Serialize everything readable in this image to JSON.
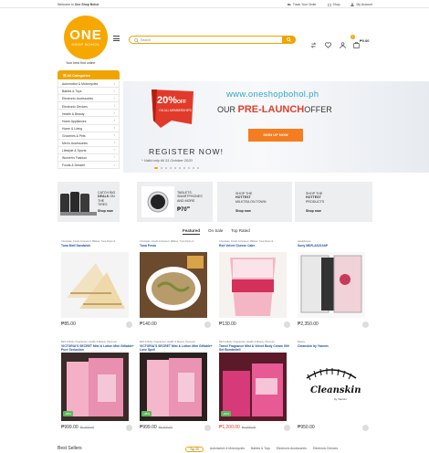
{
  "topbar": {
    "welcome_prefix": "Welcome to",
    "welcome_brand": "One Shop Bohol",
    "links": [
      "Track Your Order",
      "Shop",
      "My Account"
    ]
  },
  "header": {
    "logo_line1": "ONE",
    "logo_line2": "SHOP BOHOL",
    "tagline": "Your best find online",
    "search_placeholder": "Search",
    "cart_count": "0",
    "cart_total": "₱0.00",
    "accent_color": "#f0a400"
  },
  "categories": {
    "title": "All Categories",
    "items": [
      "Automotive & Motorcycles",
      "Babies & Toys",
      "Electronic Accessories",
      "Electronic Devices",
      "Health & Beauty",
      "Home Appliances",
      "Home & Living",
      "Groceries & Pets",
      "Men's Accessories",
      "Lifestyle & Sports",
      "Women's Fashion",
      "Foods & Dessert"
    ]
  },
  "hero": {
    "discount": "20%",
    "discount_off": "OFF",
    "discount_sub": "ON ALL MEMBERSHIPS",
    "register": "REGISTER NOW!",
    "valid": "* Valid only till 31 October 2020",
    "url": "www.oneshopbohol.ph",
    "prelaunch_pre": "OUR",
    "prelaunch_main": "PRE-LAUNCH",
    "prelaunch_post": "OFFER",
    "signup": "SIGN UP NOW"
  },
  "promos": [
    {
      "l1": "CATCH BIG",
      "l2": "DEALS",
      "l2b": "ON THE",
      "l3": "TIRES",
      "shop": "Shop now"
    },
    {
      "l1": "TABLETS,",
      "l2": "SMARTPHONES",
      "l3": "AND MORE",
      "price": "₱70",
      "sup": "99",
      "shop": ""
    },
    {
      "l1": "SHOP THE",
      "l2": "HOTTEST",
      "l3": "MILKTEA ON TOWN",
      "shop": "Shop now"
    },
    {
      "l1": "SHOP THE",
      "l2": "HOTTEST",
      "l3": "PRODUCTS",
      "shop": "Shop now"
    }
  ],
  "product_tabs": [
    "Featured",
    "On Sale",
    "Top Rated"
  ],
  "products": [
    {
      "cat": "Chocolate, Foods & Dessert, Milktea, Tuna Pesto &",
      "name": "Tuna Melt Sandwich",
      "price": "₱85.00",
      "old": ""
    },
    {
      "cat": "Chocolate, Foods & Dessert, Milktea, Tuna Pesto &",
      "name": "Tuna Pesto",
      "price": "₱140.00",
      "old": ""
    },
    {
      "cat": "Chocolate, Foods & Dessert, Milktea, Tuna Pesto &",
      "name": "Red Velvet Cheese Cake",
      "price": "₱130.00",
      "old": ""
    },
    {
      "cat": "Headphones",
      "name": "Sony MDR-AS210AP",
      "price": "₱2,350.00",
      "old": ""
    },
    {
      "cat": "Bath & Body, Fragrances, Health & Beauty, Personal",
      "name": "VICTORIA'S SECRET Mist & Lotion Mini Giftable+ Pure Seduction",
      "price": "₱999.00",
      "old": "₱1,600.00",
      "sale": "-38%"
    },
    {
      "cat": "Bath & Body, Fragrances, Health & Beauty, Personal",
      "name": "VICTORIA'S SECRET Mist & Lotion Mini Giftable+ Love Spell",
      "price": "₱999.00",
      "old": "₱1,600.00",
      "sale": "-38%"
    },
    {
      "cat": "Bath & Body, Fragrances, Health & Beauty, Personal",
      "name": "Travel Fragrance Mist & Velvet Body Cream Gift Set Bombshell",
      "price": "₱1,200.00",
      "old": "₱1,500.00",
      "sale": "-20%"
    },
    {
      "cat": "Beauty",
      "name": "Cleanskin by Yasmin",
      "price": "₱950.00",
      "old": ""
    }
  ],
  "cleanskin_logo": "Cleanskin",
  "cleanskin_by": "by Yasmin",
  "bestsellers": {
    "title": "Best Sellers",
    "tabs": [
      "Top 20",
      "Automotive & Motorcycles",
      "Babies & Toys",
      "Electronic Accessories",
      "Electronic Devices"
    ]
  }
}
